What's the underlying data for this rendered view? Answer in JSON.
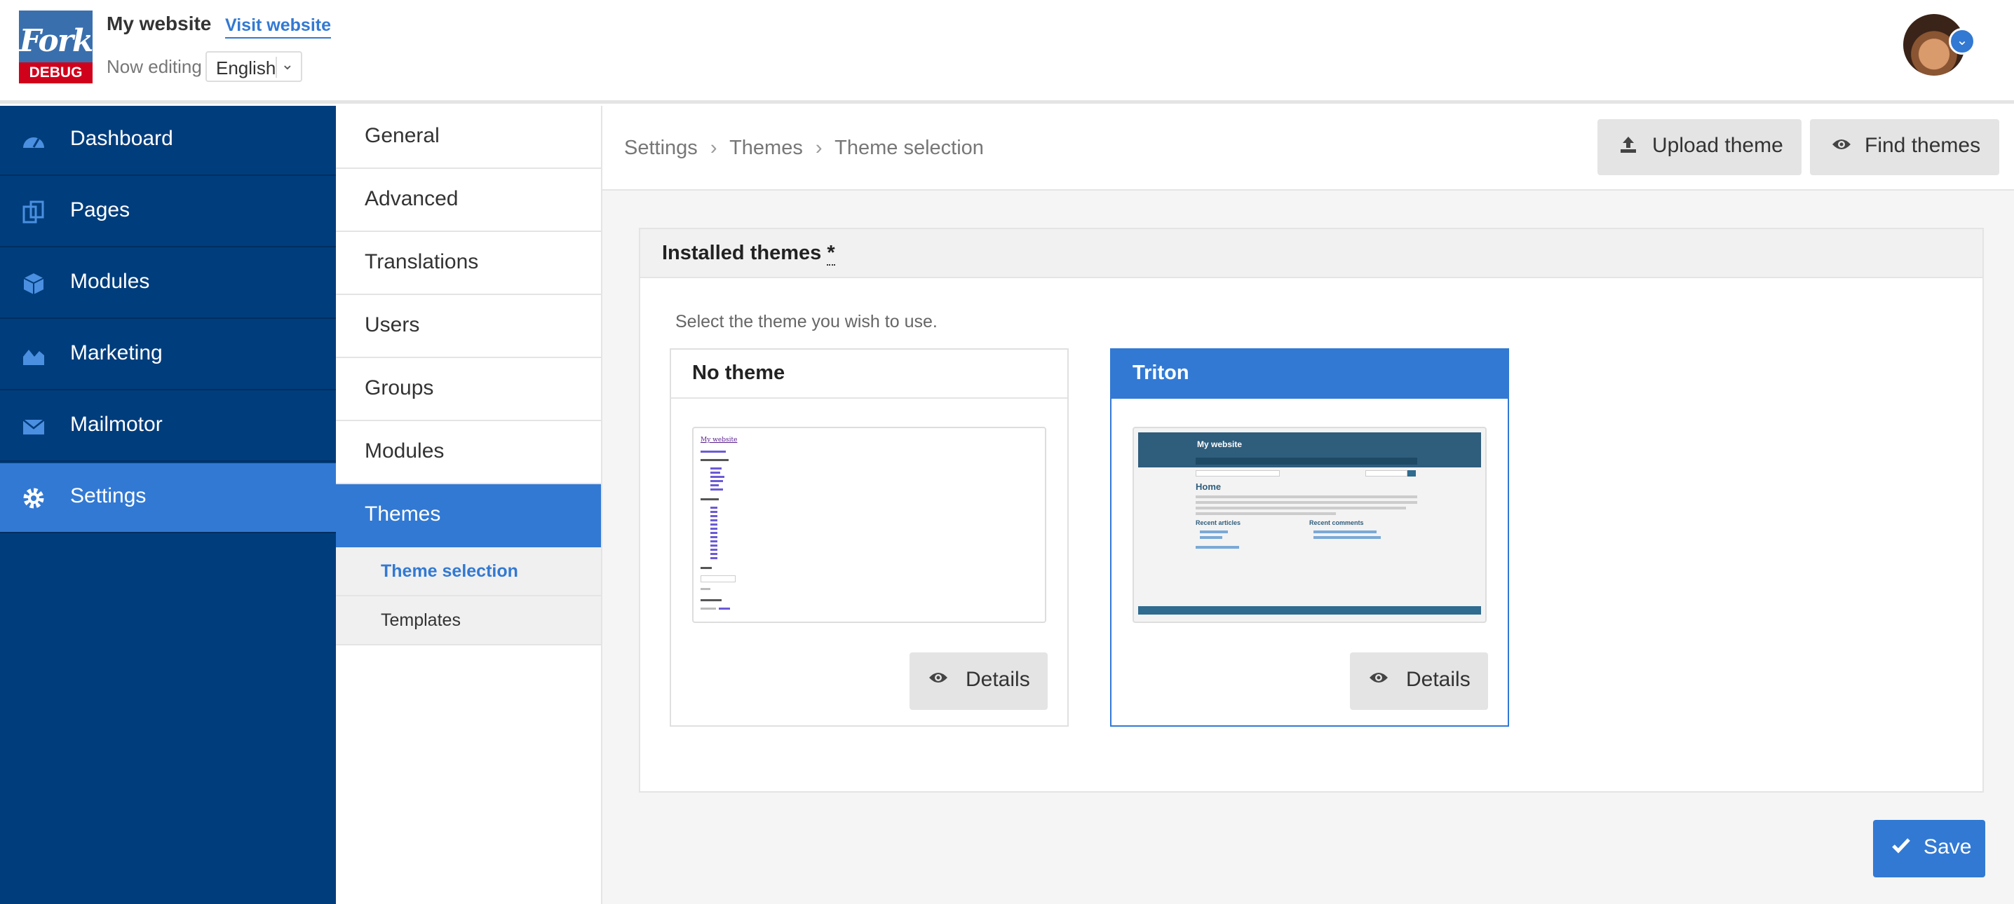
{
  "header": {
    "logo_text": "Fork",
    "logo_badge": "DEBUG",
    "site_name": "My website",
    "visit_link": "Visit website",
    "now_editing_label": "Now editing",
    "language": "English"
  },
  "sidebar": {
    "items": [
      {
        "label": "Dashboard",
        "icon": "dashboard-icon"
      },
      {
        "label": "Pages",
        "icon": "pages-icon"
      },
      {
        "label": "Modules",
        "icon": "cube-icon"
      },
      {
        "label": "Marketing",
        "icon": "area-chart-icon"
      },
      {
        "label": "Mailmotor",
        "icon": "envelope-icon"
      },
      {
        "label": "Settings",
        "icon": "gear-icon",
        "active": true
      }
    ]
  },
  "subnav": {
    "items": [
      "General",
      "Advanced",
      "Translations",
      "Users",
      "Groups",
      "Modules",
      "Themes"
    ],
    "active": "Themes",
    "children": [
      "Theme selection",
      "Templates"
    ],
    "current_child": "Theme selection"
  },
  "breadcrumb": {
    "items": [
      "Settings",
      "Themes",
      "Theme selection"
    ],
    "separator": "›"
  },
  "actions": {
    "upload_label": "Upload theme",
    "find_label": "Find themes"
  },
  "panel": {
    "title": "Installed themes",
    "required_marker": "*",
    "hint": "Select the theme you wish to use."
  },
  "themes": [
    {
      "name": "No theme",
      "details_label": "Details",
      "selected": false,
      "preview": {
        "title": "My website"
      }
    },
    {
      "name": "Triton",
      "details_label": "Details",
      "selected": true,
      "preview": {
        "title": "My website",
        "heading": "Home",
        "col1": "Recent articles",
        "col2": "Recent comments"
      }
    }
  ],
  "save_label": "Save",
  "colors": {
    "sidebar_bg": "#003d7c",
    "accent": "#3279d3",
    "debug_red": "#d0021b"
  }
}
